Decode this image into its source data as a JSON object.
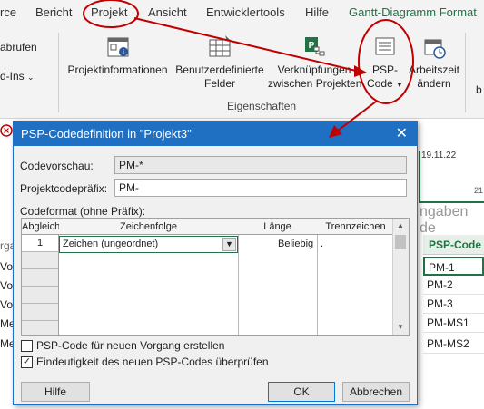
{
  "ribbon": {
    "tabs": {
      "resource_cut": "rce",
      "report": "Bericht",
      "project": "Projekt",
      "view": "Ansicht",
      "developer": "Entwicklertools",
      "help": "Hilfe",
      "gantt_format": "Gantt-Diagramm Format"
    },
    "left_cut": {
      "line1": "abrufen",
      "line2": "d-Ins"
    },
    "buttons": {
      "project_info": {
        "line1": "Projektinformationen",
        "line2": ""
      },
      "custom_fields": {
        "line1": "Benutzerdefinierte",
        "line2": "Felder"
      },
      "links": {
        "line1": "Verknüpfungen",
        "line2": "zwischen Projekten"
      },
      "wbs": {
        "line1": "PSP-",
        "line2": "Code"
      },
      "working_time": {
        "line1": "Arbeitszeit",
        "line2": "ändern"
      }
    },
    "right_cut": "b",
    "group_label": "Eigenschaften"
  },
  "background": {
    "date_cut": "19.11.22",
    "date_cut2": "21",
    "column_cut": "ngaben de",
    "wbs_column_header": "PSP-Code",
    "wbs_codes": [
      "PM-1",
      "PM-2",
      "PM-3",
      "PM-MS1",
      "PM-MS2"
    ],
    "left_cut_header": "rga",
    "left_cut_rows": [
      "Vor",
      "Vor",
      "Vor",
      "Me",
      "Me"
    ]
  },
  "dialog": {
    "title": "PSP-Codedefinition in \"Projekt3\"",
    "code_preview_label": "Codevorschau:",
    "code_preview_value": "PM-*",
    "prefix_label": "Projektcodepräfix:",
    "prefix_value": "PM-",
    "format_label": "Codeformat (ohne Präfix):",
    "columns": [
      "Abgleich",
      "Zeichenfolge",
      "Länge",
      "Trennzeichen"
    ],
    "rows": [
      {
        "level": "1",
        "sequence": "Zeichen (ungeordnet)",
        "length": "Beliebig",
        "separator": "."
      }
    ],
    "checkbox_new_task": {
      "label": "PSP-Code für neuen Vorgang erstellen",
      "checked": false
    },
    "checkbox_unique": {
      "label": "Eindeutigkeit des neuen PSP-Codes überprüfen",
      "checked": true
    },
    "help_button": "Hilfe",
    "ok_button": "OK",
    "cancel_button": "Abbrechen"
  },
  "colors": {
    "accent_green": "#217346",
    "dialog_blue": "#1f6fc2",
    "annotation_red": "#c00000"
  },
  "icons": [
    "project-info-icon",
    "custom-fields-icon",
    "project-links-icon",
    "wbs-code-icon",
    "calendar-icon",
    "close-icon",
    "dropdown-arrow-icon",
    "warning-circle-icon"
  ]
}
